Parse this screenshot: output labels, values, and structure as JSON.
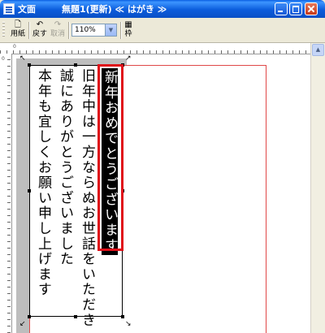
{
  "window": {
    "title": "文面",
    "doc_title": "無題1(更新) ≪ はがき ≫"
  },
  "toolbar": {
    "new_label": "用紙",
    "undo_label": "戻す",
    "cancel_label": "取消",
    "zoom_value": "110%",
    "frame_label": "枠"
  },
  "ruler": {
    "top_number": "0",
    "left_number": "0"
  },
  "document": {
    "lines": [
      "新年おめでとうございます",
      "旧年中は一方ならぬお世話をいただき",
      "誠にありがとうございました",
      "本年も宜しくお願い申し上げます"
    ]
  },
  "colors": {
    "titlebar": "#0a5fe3",
    "highlight_box": "#e0101a",
    "page_border": "#e04848"
  }
}
